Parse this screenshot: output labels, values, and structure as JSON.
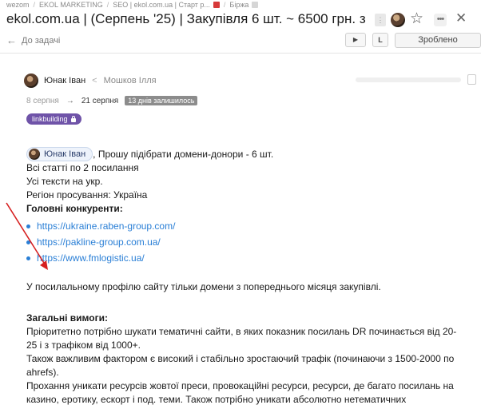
{
  "breadcrumb": [
    "wezom",
    "EKOL MARKETING",
    "SEO | ekol.com.ua | Старт р...",
    "Біржа"
  ],
  "header": {
    "title": "ekol.com.ua | (Серпень '25) | Закупівля 6 шт. ~ 6500 грн. з к..."
  },
  "toolbar": {
    "back_label": "До задачі",
    "done_label": "Зроблено",
    "play_symbol": "▶",
    "l_symbol": "L"
  },
  "task": {
    "assignee": "Юнак Іван",
    "reporter": "Мошков Ілля",
    "date_start": "8 серпня",
    "date_end": "21 серпня",
    "days_left": "13 днів залишилось",
    "tag": "linkbuilding"
  },
  "description": {
    "mention": "Юнак Іван",
    "intro": ", Прошу підібрати домени-донори - 6 шт.",
    "lines": [
      "Всі статті по 2 посилання",
      "Усі тексти на укр.",
      "Регіон просування:  Україна"
    ],
    "competitors_heading": "Головні конкуренти:",
    "links": [
      "https://ukraine.raben-group.com/",
      "https://pakline-group.com.ua/",
      "https://www.fmlogistic.ua/"
    ],
    "profile_note": "У посилальному профілю сайту тільки домени з попереднього місяця закупівлі.",
    "requirements_heading": "Загальні вимоги:",
    "req_p1": "Пріоритетно потрібно шукати тематичні сайти, в яких показник посилань DR починається від 20-25 і з трафіком від 1000+.",
    "req_p2": "Також важливим фактором є високий і стабільно зростаючий трафік (починаючи з 1500-2000 по ahrefs).",
    "req_p3": "Прохання уникати ресурсів жовтої преси, провокаційні ресурси, ресурси, де багато посилань на казино, еротику, ескорт і под. теми. Також потрібно уникати абсолютно нетематичних майданчиків."
  },
  "icons": {
    "star": "☆",
    "more": "•••",
    "close": "✕",
    "back": "←",
    "assign_arrow": "<",
    "date_arrow": "→"
  },
  "colors": {
    "tag_bg": "#6f53a8",
    "link": "#2a7fd6",
    "annotation_arrow": "#d62020"
  }
}
